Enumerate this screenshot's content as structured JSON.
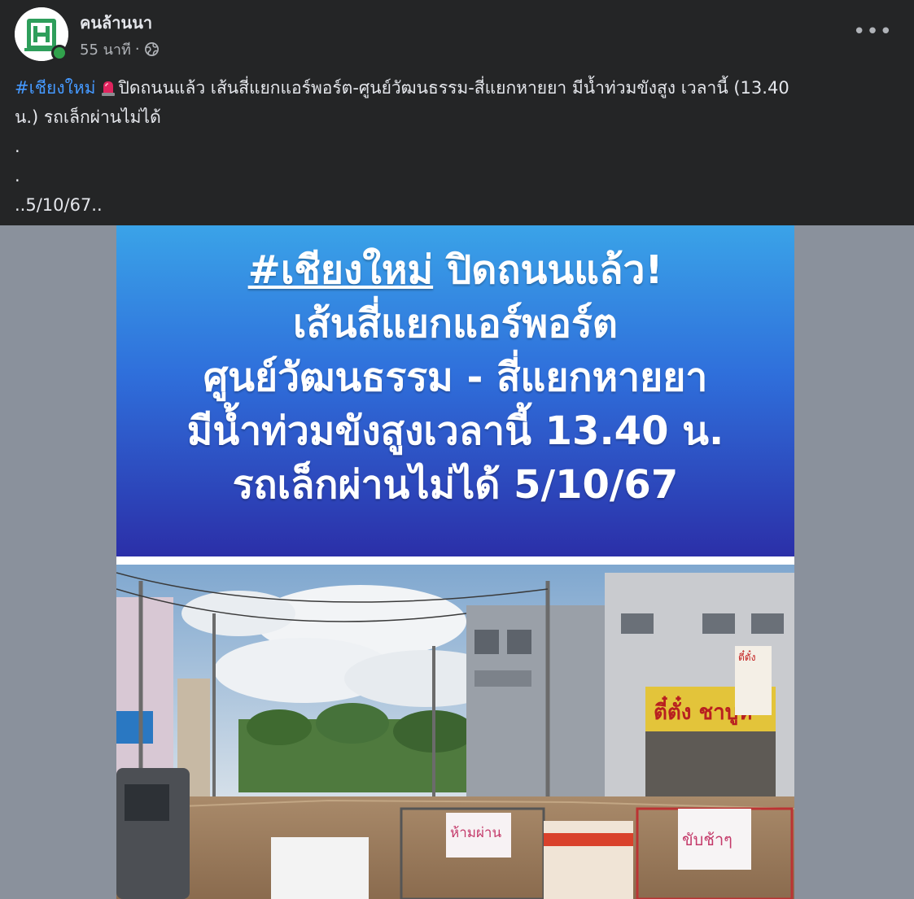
{
  "post": {
    "author": "คนล้านนา",
    "time": "55 นาที",
    "separator": "·",
    "more_label": "•••",
    "text": {
      "hashtag": "#เชียงใหม่",
      "line1": "ปิดถนนแล้ว เส้นสี่แยกแอร์พอร์ต-ศูนย์วัฒนธรรม-สี่แยกหายยา มีน้ำท่วมขังสูง เวลานี้ (13.40",
      "line2": "น.) รถเล็กผ่านไม่ได้",
      "line3": ".",
      "line4": ".",
      "line5": "..5/10/67.."
    }
  },
  "image": {
    "banner": {
      "hashtag": "#เชียงใหม่",
      "line1_rest": " ปิดถนนแล้ว!",
      "line2": "เส้นสี่แยกแอร์พอร์ต",
      "line3": "ศูนย์วัฒนธรรม - สี่แยกหายยา",
      "line4": "มีน้ำท่วมขังสูงเวลานี้ 13.40 น.",
      "line5": "รถเล็กผ่านไม่ได้ 5/10/67"
    },
    "photo": {
      "sign_left": "ห้ามผ่าน",
      "sign_right": "ขับช้าๆ",
      "shop_sign": "ตี๋ตั๋ง ชาบูห",
      "shop_sign_small": "ตี๋ตั๋ง"
    }
  },
  "colors": {
    "background": "#242526",
    "hashtag": "#4599ff",
    "online": "#31a24c",
    "image_backdrop": "#8a919c"
  },
  "icons": [
    "page-logo-icon",
    "globe-icon",
    "siren-icon",
    "more-options-icon"
  ]
}
